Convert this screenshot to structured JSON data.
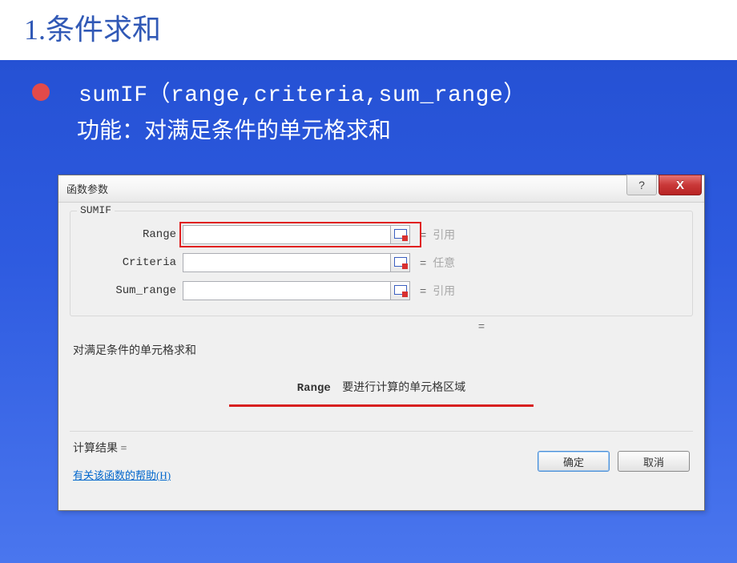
{
  "slide": {
    "title": "1.条件求和",
    "formula": "sumIF（range,criteria,sum_range）",
    "description": "功能：对满足条件的单元格求和"
  },
  "dialog": {
    "title": "函数参数",
    "help_symbol": "?",
    "close_symbol": "X",
    "function_name": "SUMIF",
    "rows": [
      {
        "label": "Range",
        "value": "",
        "hint": "引用",
        "highlighted": true
      },
      {
        "label": "Criteria",
        "value": "",
        "hint": "任意",
        "highlighted": false
      },
      {
        "label": "Sum_range",
        "value": "",
        "hint": "引用",
        "highlighted": false
      }
    ],
    "equals": "=",
    "function_desc": "对满足条件的单元格求和",
    "param_label": "Range",
    "param_desc": "要进行计算的单元格区域",
    "result_label": "计算结果 =",
    "help_link": "有关该函数的帮助(H)",
    "ok_button": "确定",
    "cancel_button": "取消"
  }
}
